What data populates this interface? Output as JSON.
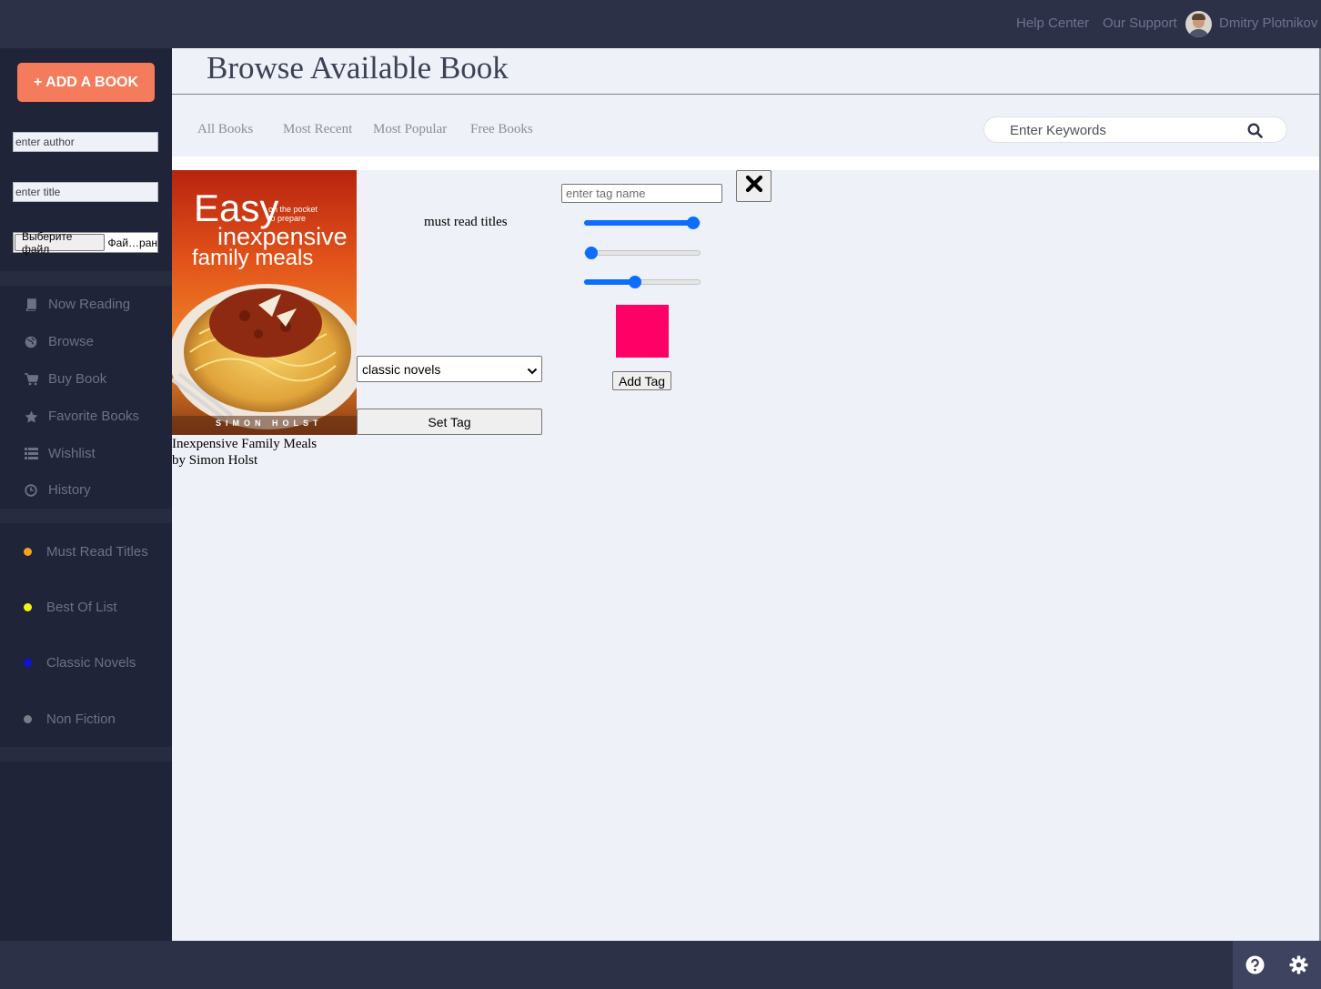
{
  "topbar": {
    "help_center": "Help Center",
    "our_support": "Our Support",
    "user_name": "Dmitry Plotnikov"
  },
  "sidebar": {
    "add_book": "+ ADD A BOOK",
    "author_placeholder": "enter author",
    "title_placeholder": "enter title",
    "file_button": "Выберите файл",
    "file_label": "Фай…ран",
    "nav": [
      {
        "label": "Now Reading",
        "icon": "book-icon"
      },
      {
        "label": "Browse",
        "icon": "globe-icon"
      },
      {
        "label": "Buy Book",
        "icon": "cart-icon"
      },
      {
        "label": "Favorite Books",
        "icon": "star-icon"
      },
      {
        "label": "Wishlist",
        "icon": "list-icon"
      },
      {
        "label": "History",
        "icon": "clock-icon"
      }
    ],
    "tags": [
      {
        "label": "Must Read Titles",
        "color": "#f7a21b"
      },
      {
        "label": "Best Of List",
        "color": "#f4f416"
      },
      {
        "label": "Classic Novels",
        "color": "#1010e0"
      },
      {
        "label": "Non Fiction",
        "color": "#7a7d88"
      }
    ]
  },
  "main": {
    "page_title": "Browse Available Book",
    "tabs": [
      "All Books",
      "Most Recent",
      "Most Popular",
      "Free Books"
    ],
    "search_placeholder": "Enter Keywords"
  },
  "book": {
    "title": "Inexpensive Family Meals",
    "author_line": "by Simon Holst",
    "cover": {
      "word_easy": "Easy",
      "tagline_1": "on the pocket",
      "tagline_2": "to prepare",
      "line_1": "inexpensive",
      "line_2": "family meals",
      "author_caps": "SIMON HOLST"
    }
  },
  "tag_editor": {
    "current_tag_label": "must read titles",
    "select_value": "classic novels",
    "set_tag": "Set Tag",
    "tag_name_placeholder": "enter tag name",
    "sliders": [
      1.0,
      0.0,
      0.43
    ],
    "swatch_color": "#ff0066",
    "add_tag": "Add Tag"
  },
  "colors": {
    "accent": "#f47c5c",
    "topbar": "#2c3148",
    "sidebar": "#1f2438",
    "slider": "#0d6efd"
  }
}
